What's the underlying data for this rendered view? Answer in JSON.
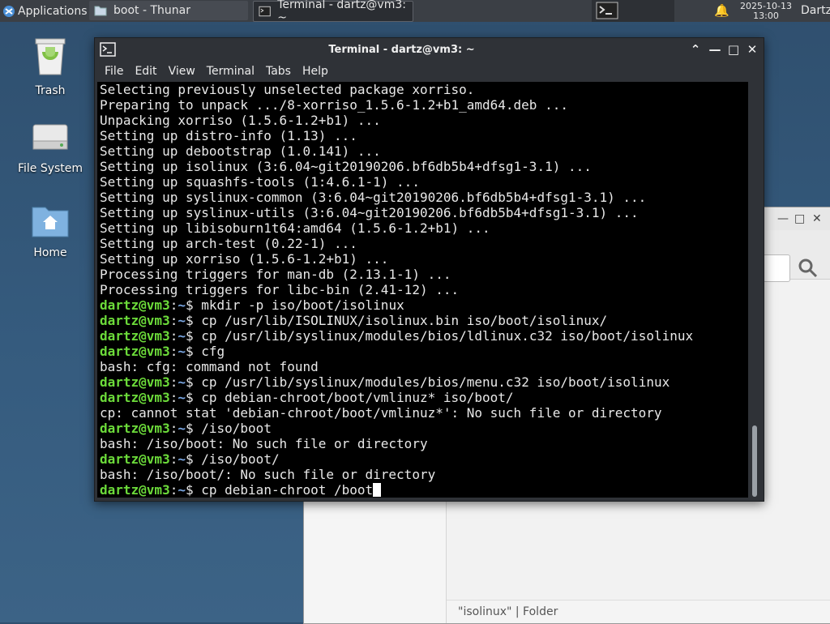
{
  "panel": {
    "applications_label": "Applications",
    "tasks": [
      {
        "label": "boot - Thunar"
      },
      {
        "label": "Terminal - dartz@vm3: ~"
      }
    ],
    "date": "2025-10-13",
    "time": "13:00",
    "user": "Dartz"
  },
  "desktop": {
    "icons": [
      {
        "label": "Trash"
      },
      {
        "label": "File System"
      },
      {
        "label": "Home"
      }
    ]
  },
  "thunar": {
    "status_text": "\"isolinux\"  |  Folder"
  },
  "terminal": {
    "title": "Terminal - dartz@vm3: ~",
    "menu": [
      "File",
      "Edit",
      "View",
      "Terminal",
      "Tabs",
      "Help"
    ],
    "prompt_user": "dartz@vm3",
    "prompt_path": "~",
    "lines": [
      {
        "type": "out",
        "text": "Selecting previously unselected package xorriso."
      },
      {
        "type": "out",
        "text": "Preparing to unpack .../8-xorriso_1.5.6-1.2+b1_amd64.deb ..."
      },
      {
        "type": "out",
        "text": "Unpacking xorriso (1.5.6-1.2+b1) ..."
      },
      {
        "type": "out",
        "text": "Setting up distro-info (1.13) ..."
      },
      {
        "type": "out",
        "text": "Setting up debootstrap (1.0.141) ..."
      },
      {
        "type": "out",
        "text": "Setting up isolinux (3:6.04~git20190206.bf6db5b4+dfsg1-3.1) ..."
      },
      {
        "type": "out",
        "text": "Setting up squashfs-tools (1:4.6.1-1) ..."
      },
      {
        "type": "out",
        "text": "Setting up syslinux-common (3:6.04~git20190206.bf6db5b4+dfsg1-3.1) ..."
      },
      {
        "type": "out",
        "text": "Setting up syslinux-utils (3:6.04~git20190206.bf6db5b4+dfsg1-3.1) ..."
      },
      {
        "type": "out",
        "text": "Setting up libisoburn1t64:amd64 (1.5.6-1.2+b1) ..."
      },
      {
        "type": "out",
        "text": "Setting up arch-test (0.22-1) ..."
      },
      {
        "type": "out",
        "text": "Setting up xorriso (1.5.6-1.2+b1) ..."
      },
      {
        "type": "out",
        "text": "Processing triggers for man-db (2.13.1-1) ..."
      },
      {
        "type": "out",
        "text": "Processing triggers for libc-bin (2.41-12) ..."
      },
      {
        "type": "cmd",
        "text": "mkdir -p iso/boot/isolinux"
      },
      {
        "type": "cmd",
        "text": "cp /usr/lib/ISOLINUX/isolinux.bin iso/boot/isolinux/"
      },
      {
        "type": "cmd",
        "text": "cp /usr/lib/syslinux/modules/bios/ldlinux.c32 iso/boot/isolinux"
      },
      {
        "type": "cmd",
        "text": "cfg"
      },
      {
        "type": "out",
        "text": "bash: cfg: command not found"
      },
      {
        "type": "cmd",
        "text": "cp /usr/lib/syslinux/modules/bios/menu.c32 iso/boot/isolinux"
      },
      {
        "type": "cmd",
        "text": "cp debian-chroot/boot/vmlinuz* iso/boot/"
      },
      {
        "type": "out",
        "text": "cp: cannot stat 'debian-chroot/boot/vmlinuz*': No such file or directory"
      },
      {
        "type": "cmd",
        "text": "/iso/boot"
      },
      {
        "type": "out",
        "text": "bash: /iso/boot: No such file or directory"
      },
      {
        "type": "cmd",
        "text": "/iso/boot/"
      },
      {
        "type": "out",
        "text": "bash: /iso/boot/: No such file or directory"
      },
      {
        "type": "cmd",
        "text": "cp debian-chroot /boot",
        "cursor": true
      }
    ]
  }
}
